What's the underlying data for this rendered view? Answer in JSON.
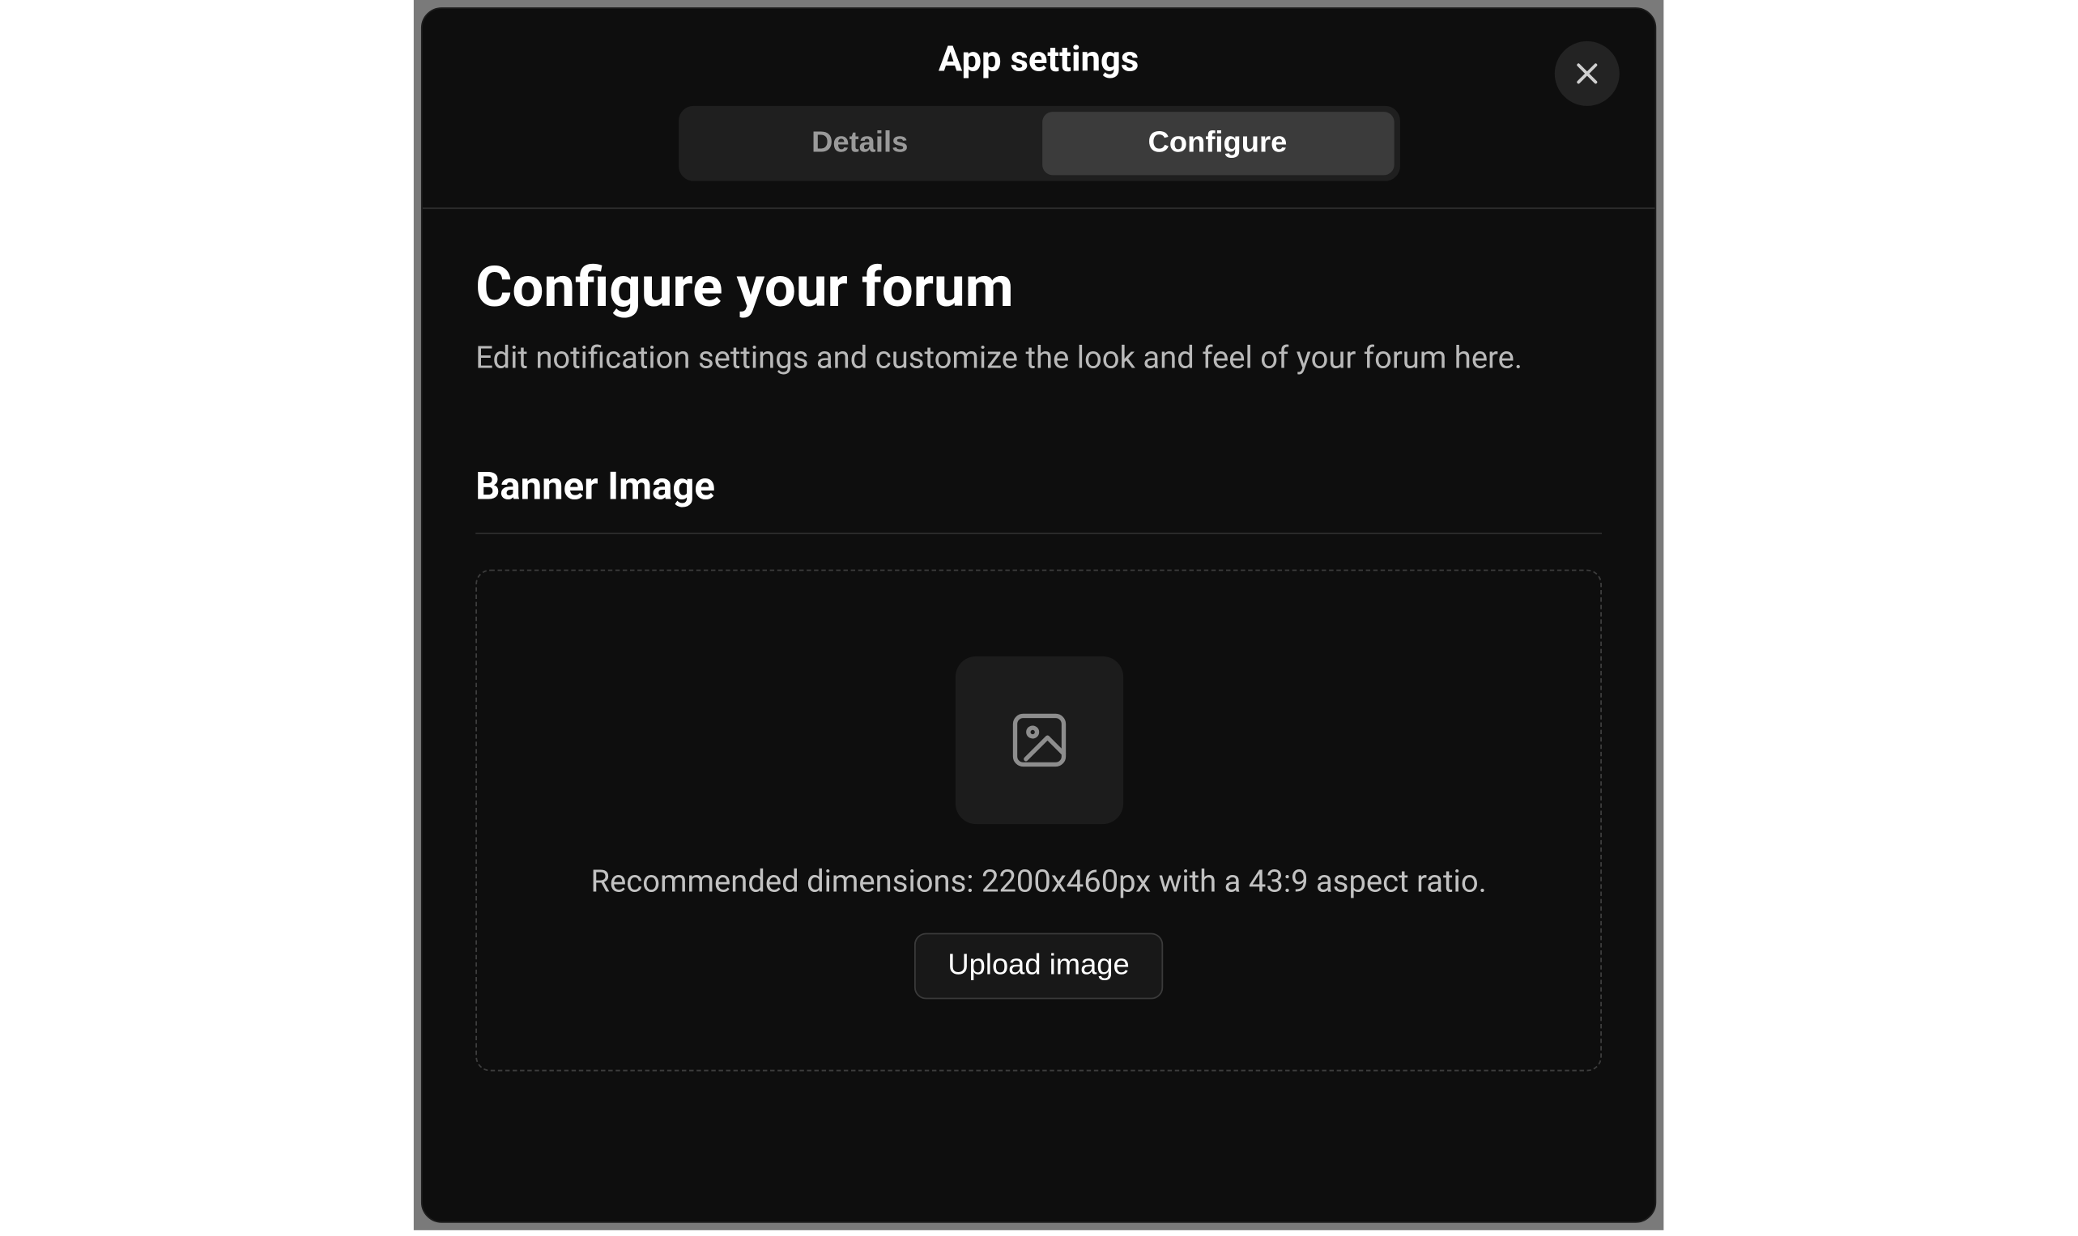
{
  "modal": {
    "title": "App settings",
    "tabs": [
      {
        "label": "Details",
        "active": false
      },
      {
        "label": "Configure",
        "active": true
      }
    ]
  },
  "configure": {
    "heading": "Configure your forum",
    "subheading": "Edit notification settings and customize the look and feel of your forum here."
  },
  "banner": {
    "section_label": "Banner Image",
    "hint": "Recommended dimensions: 2200x460px with a 43:9 aspect ratio.",
    "upload_label": "Upload image"
  }
}
